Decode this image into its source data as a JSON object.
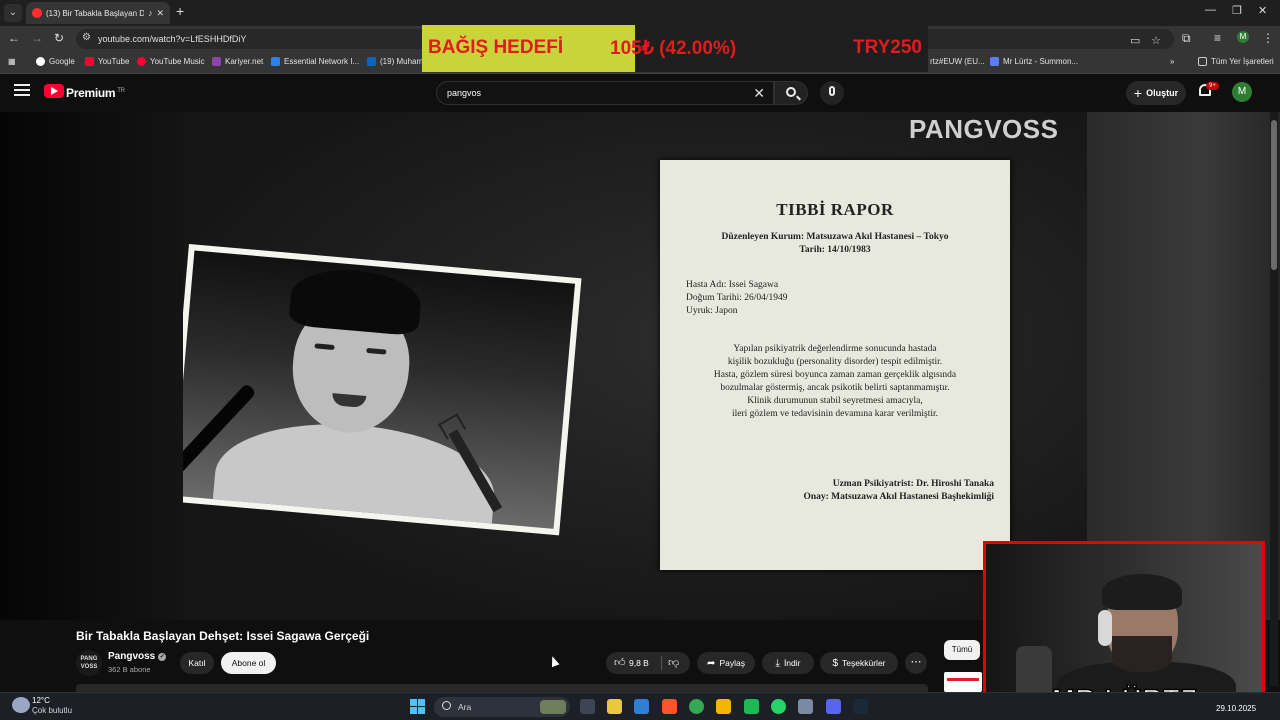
{
  "browser": {
    "tab_title": "(13) Bir Tabakla Başlayan De",
    "url": "youtube.com/watch?v=LfESHHDfDiY",
    "bookmarks": [
      "Google",
      "YouTube",
      "YouTube Music",
      "Kariyer.net",
      "Essential Network I...",
      "(19) Muhami",
      "rtz#EUW (EU...",
      "Mr Lürtz - Summon..."
    ],
    "all_bookmarks": "Tüm Yer İşaretleri"
  },
  "donation": {
    "label": "BAĞIŞ HEDEFİ",
    "progress": "105₺ (42.00%)",
    "goal": "TRY250",
    "fraction": 0.42
  },
  "youtube": {
    "brand": "Premium",
    "region": "TR",
    "search_query": "pangvos",
    "create_label": "Oluştur",
    "notifications": "9+",
    "avatar_letter": "M"
  },
  "video": {
    "channel_watermark": "PANGVOSS",
    "document": {
      "title": "TIBBİ RAPOR",
      "org": "Düzenleyen Kurum: Matsuzawa Akıl Hastanesi – Tokyo",
      "date": "Tarih: 14/10/1983",
      "fields": [
        "Hasta Adı: Issei Sagawa",
        "Doğum Tarihi: 26/04/1949",
        "Uyruk: Japon"
      ],
      "body": [
        "Yapılan psikiyatrik değerlendirme sonucunda hastada",
        "kişilik bozukluğu (personality disorder) tespit edilmiştir.",
        "Hasta, gözlem süresi boyunca zaman zaman gerçeklik algısında",
        "bozulmalar göstermiş, ancak psikotik belirti saptanmamıştır.",
        "Klinik durumunun stabil seyretmesi amacıyla,",
        "ileri gözlem ve tedavisinin devamına karar verilmiştir."
      ],
      "signature": [
        "Uzman Psikiyatrist: Dr. Hiroshi Tanaka",
        "Onay: Matsuzawa Akıl Hastanesi Başhekimliği"
      ]
    }
  },
  "watch": {
    "title": "Bir Tabakla Başlayan Dehşet: Issei Sagawa Gerçeği",
    "channel_avatar_text": "PANG VOSS",
    "channel_name": "Pangvoss",
    "subscribers": "362 B abone",
    "join_label": "Katıl",
    "subscribe_label": "Abone ol",
    "likes": "9,8 B",
    "share_label": "Paylaş",
    "download_label": "İndir",
    "thanks_label": "Teşekkürler",
    "chip_all": "Tümü"
  },
  "webcam": {
    "streamer_name": "MR LÜRTZ"
  },
  "taskbar": {
    "temperature": "12°C",
    "weather": "Çok bulutlu",
    "search_label": "Ara",
    "date": "29.10.2025"
  }
}
